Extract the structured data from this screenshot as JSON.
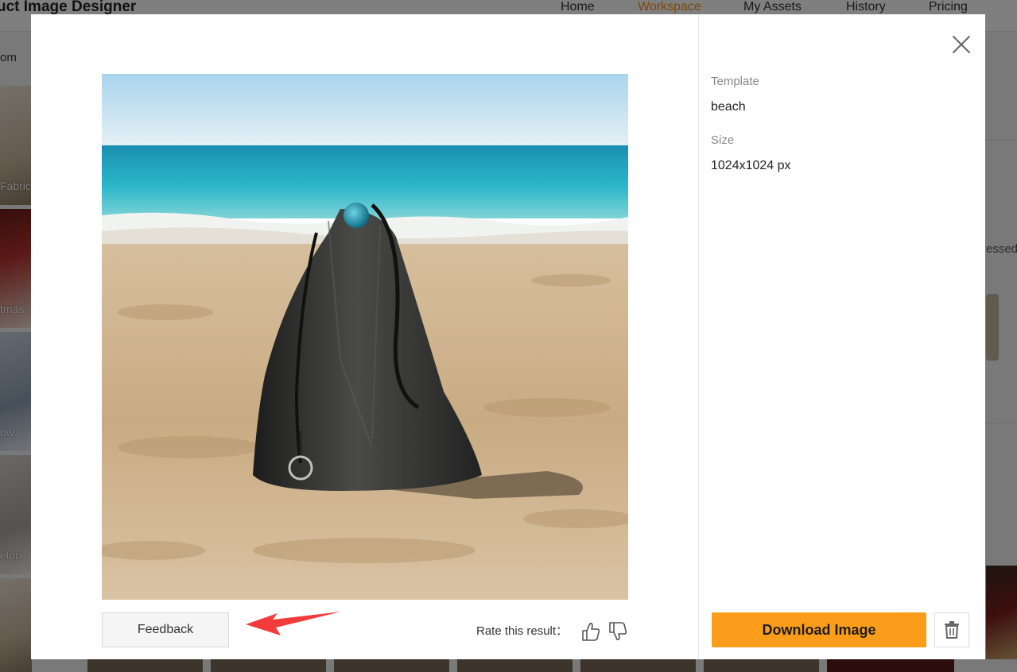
{
  "background": {
    "app_title": "uct Image Designer",
    "nav": [
      "Home",
      "Workspace",
      "My Assets",
      "History",
      "Pricing"
    ],
    "left_text": "om",
    "tile_labels": [
      "Fabric",
      "tmas",
      "ow",
      "etop"
    ],
    "right_text": "essed",
    "accent_color": "#f5931e"
  },
  "modal": {
    "close_icon": "close-icon",
    "template_label": "Template",
    "template_value": "beach",
    "size_label": "Size",
    "size_value": "1024x1024 px",
    "feedback_label": "Feedback",
    "rate_label": "Rate this result：",
    "download_label": "Download Image",
    "download_color": "#fb9d1b",
    "thumbs_up_icon": "thumbs-up-icon",
    "thumbs_down_icon": "thumbs-down-icon",
    "delete_icon": "trash-icon",
    "annotation_color": "#f23b3b"
  }
}
